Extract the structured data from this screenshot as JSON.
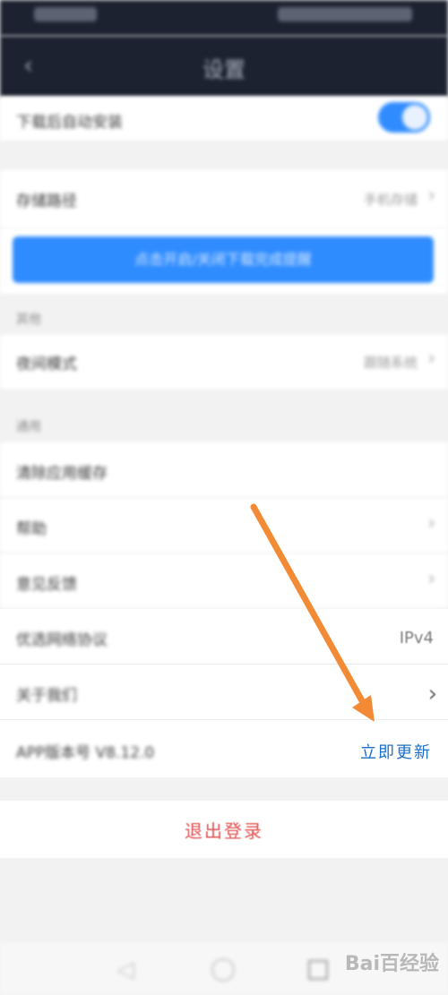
{
  "nav": {
    "title": "设置"
  },
  "rows": {
    "download_label": "下载后自动安装",
    "storage_label": "存储路径",
    "storage_value": "手机存储",
    "blue_button_label": "点击开启/关闭下载完成提醒",
    "section_other_header": "其他",
    "theme_label": "夜间模式",
    "theme_value": "跟随系统",
    "section_about_header": "通用",
    "clear_cache_label": "清除应用缓存",
    "help_label": "帮助",
    "feedback_label": "意见反馈",
    "network_label": "优选网络协议",
    "network_value": "IPv4",
    "about_label": "关于我们",
    "version_label": "APP版本号 V8.12.0",
    "update_link": "立即更新"
  },
  "logout": {
    "label": "退出登录"
  },
  "watermark": {
    "text": "Bai百经验"
  },
  "colors": {
    "accent": "#2f8cff",
    "nav_bg": "#1c2230",
    "logout": "#e25050",
    "link": "#1b6fc9",
    "arrow": "#f28a36"
  }
}
